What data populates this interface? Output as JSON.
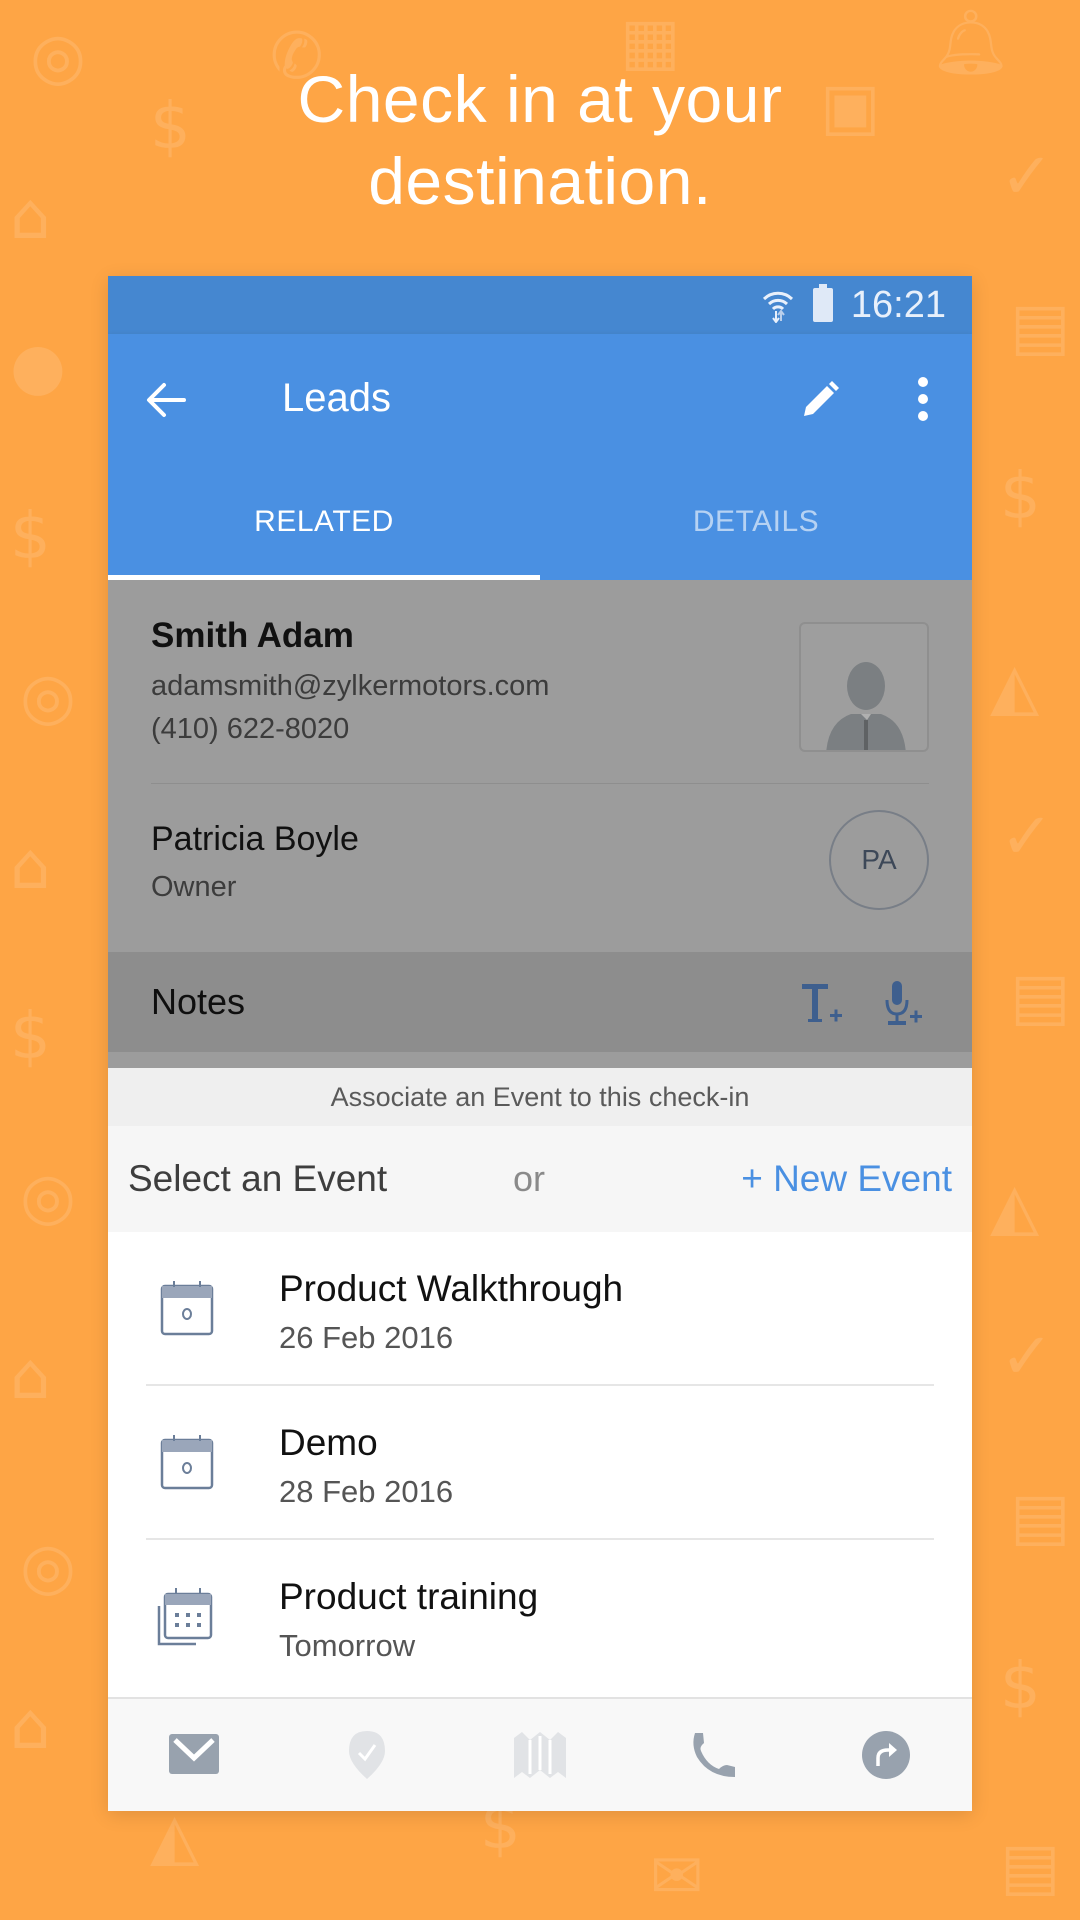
{
  "headline": {
    "line1": "Check in at your",
    "line2": "destination."
  },
  "colors": {
    "background": "#FEA545",
    "status_bar": "#4587D0",
    "app_bar": "#4A90E2",
    "accent": "#4A90E2",
    "icon_gray": "#98A2AE"
  },
  "status_bar": {
    "time": "16:21",
    "icons": [
      "wifi-icon",
      "battery-icon"
    ]
  },
  "app_bar": {
    "title": "Leads",
    "back_icon": "arrow-left-icon",
    "edit_icon": "pencil-icon",
    "more_icon": "more-vertical-icon"
  },
  "tabs": [
    {
      "label": "RELATED",
      "active": true
    },
    {
      "label": "DETAILS",
      "active": false
    }
  ],
  "contact": {
    "name": "Smith Adam",
    "email": "adamsmith@zylkermotors.com",
    "phone": "(410) 622-8020"
  },
  "owner": {
    "name": "Patricia Boyle",
    "role": "Owner",
    "initials": "PA"
  },
  "notes": {
    "label": "Notes",
    "icons": [
      "add-text-note-icon",
      "add-voice-note-icon"
    ]
  },
  "check_in": {
    "header": "Associate an Event to this check-in",
    "select_label": "Select an Event",
    "or_label": "or",
    "new_event_label": "+ New Event"
  },
  "events": [
    {
      "title": "Product Walkthrough",
      "date": "26 Feb 2016",
      "icon": "calendar-event-icon"
    },
    {
      "title": "Demo",
      "date": "28 Feb 2016",
      "icon": "calendar-event-icon"
    },
    {
      "title": "Product training",
      "date": "Tomorrow",
      "icon": "calendar-recurring-icon"
    }
  ],
  "bottom_actions": [
    {
      "name": "email",
      "icon": "mail-icon",
      "enabled": true
    },
    {
      "name": "check-in",
      "icon": "location-check-icon",
      "enabled": false
    },
    {
      "name": "map",
      "icon": "map-icon",
      "enabled": false
    },
    {
      "name": "call",
      "icon": "phone-icon",
      "enabled": true
    },
    {
      "name": "share",
      "icon": "share-icon",
      "enabled": true
    }
  ]
}
